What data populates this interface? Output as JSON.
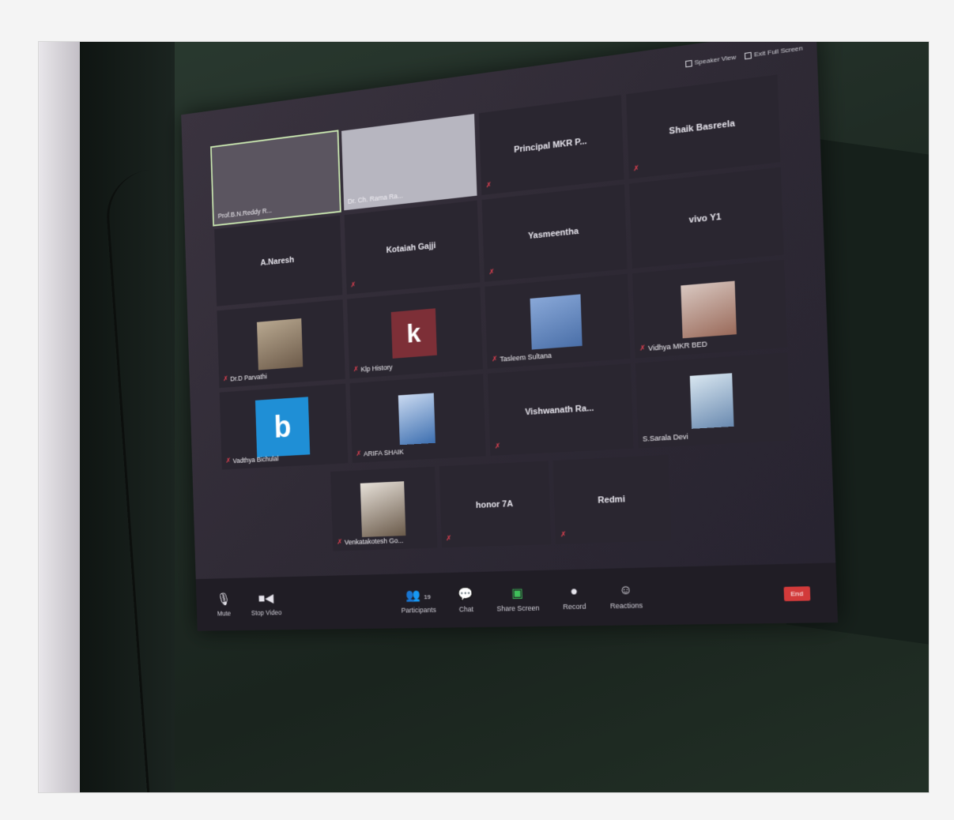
{
  "view_buttons": [
    "Speaker View",
    "Exit Full Screen"
  ],
  "participants": [
    {
      "name": "Prof.B.N.Reddy R...",
      "kind": "video-dark",
      "muted": false
    },
    {
      "name": "Dr. Ch. Rama Ra...",
      "kind": "video-light",
      "muted": false
    },
    {
      "name": "Principal MKR P...",
      "kind": "name",
      "muted": true
    },
    {
      "name": "Shaik Basreela",
      "kind": "name",
      "muted": true
    },
    {
      "name": "A.Naresh",
      "kind": "name",
      "muted": false
    },
    {
      "name": "Kotaiah Gajji",
      "kind": "name",
      "muted": true
    },
    {
      "name": "Yasmeentha",
      "kind": "name",
      "muted": true
    },
    {
      "name": "vivo Y1",
      "kind": "name",
      "muted": false
    },
    {
      "name": "Dr.D Parvathi",
      "kind": "photo",
      "muted": true
    },
    {
      "name": "Klp History",
      "kind": "letter",
      "letter": "k",
      "muted": true
    },
    {
      "name": "Tasleem Sultana",
      "kind": "photo",
      "muted": true
    },
    {
      "name": "Vidhya MKR BED",
      "kind": "photo",
      "muted": true
    },
    {
      "name": "Vadthya Bichulal",
      "kind": "letter",
      "letter": "b",
      "muted": true
    },
    {
      "name": "ARIFA SHAIK",
      "kind": "photo",
      "muted": true
    },
    {
      "name": "Vishwanath Ra...",
      "kind": "name",
      "muted": true
    },
    {
      "name": "S.Sarala Devi",
      "kind": "photo",
      "muted": false
    }
  ],
  "last_row": [
    {
      "name": "Venkatakotesh Go...",
      "kind": "photo",
      "muted": true
    },
    {
      "name": "honor 7A",
      "kind": "name",
      "muted": true
    },
    {
      "name": "Redmi",
      "kind": "name",
      "muted": true
    }
  ],
  "toolbar": {
    "mute": "Mute",
    "stop_video": "Stop Video",
    "participants": "Participants",
    "participants_count": "19",
    "chat": "Chat",
    "share": "Share Screen",
    "record": "Record",
    "reactions": "Reactions",
    "end": "End"
  }
}
